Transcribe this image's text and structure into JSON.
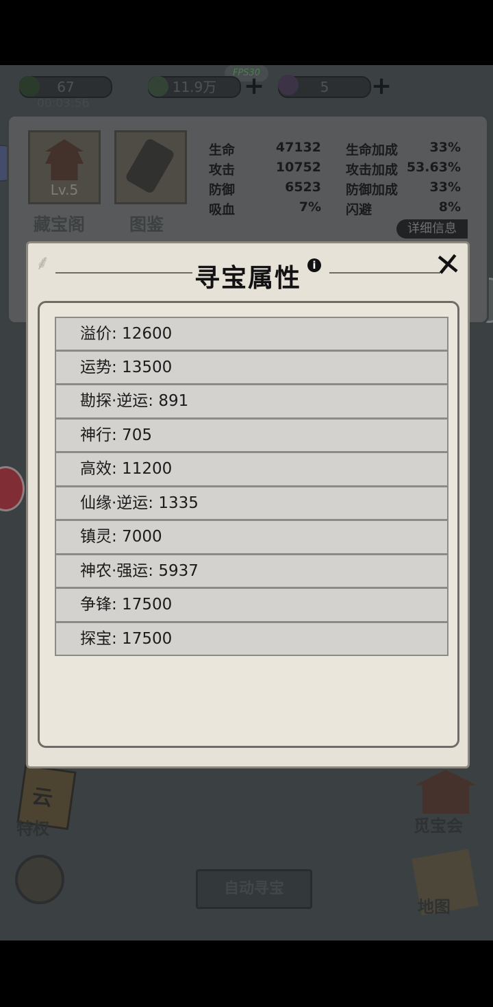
{
  "hud": {
    "fps": "FPS30",
    "timer": "00:03:56",
    "resources": [
      {
        "value": "67",
        "icon": "green-flame-icon"
      },
      {
        "value": "11.9万",
        "icon": "jade-scroll-icon"
      },
      {
        "value": "5",
        "icon": "purple-crystal-icon"
      }
    ]
  },
  "panel": {
    "slots": [
      {
        "label": "藏宝阁",
        "badge": "Lv.5",
        "icon": "pagoda-icon"
      },
      {
        "label": "图鉴",
        "icon": "scroll-icon"
      }
    ],
    "stats": [
      {
        "name": "生命",
        "value": "47132",
        "bonus_name": "生命加成",
        "bonus_value": "33%"
      },
      {
        "name": "攻击",
        "value": "10752",
        "bonus_name": "攻击加成",
        "bonus_value": "53.63%"
      },
      {
        "name": "防御",
        "value": "6523",
        "bonus_name": "防御加成",
        "bonus_value": "33%"
      },
      {
        "name": "吸血",
        "value": "7%",
        "bonus_name": "闪避",
        "bonus_value": "8%"
      }
    ],
    "detail_button": "详细信息"
  },
  "bottom": {
    "privilege": "特权",
    "privilege_badge": "云",
    "treasure_fair": "觅宝会",
    "map": "地图",
    "auto_button": "自动寻宝"
  },
  "modal": {
    "title": "寻宝属性",
    "attributes": [
      "溢价: 12600",
      "运势: 13500",
      "勘探·逆运: 891",
      "神行: 705",
      "高效: 11200",
      "仙缘·逆运: 1335",
      "镇灵: 7000",
      "神农·强运: 5937",
      "争锋: 17500",
      "探宝: 17500"
    ]
  },
  "colors": {
    "modal_bg": "#e7e2d8",
    "row_bg": "#d4d2ce",
    "fps_text": "#7cd17c"
  }
}
